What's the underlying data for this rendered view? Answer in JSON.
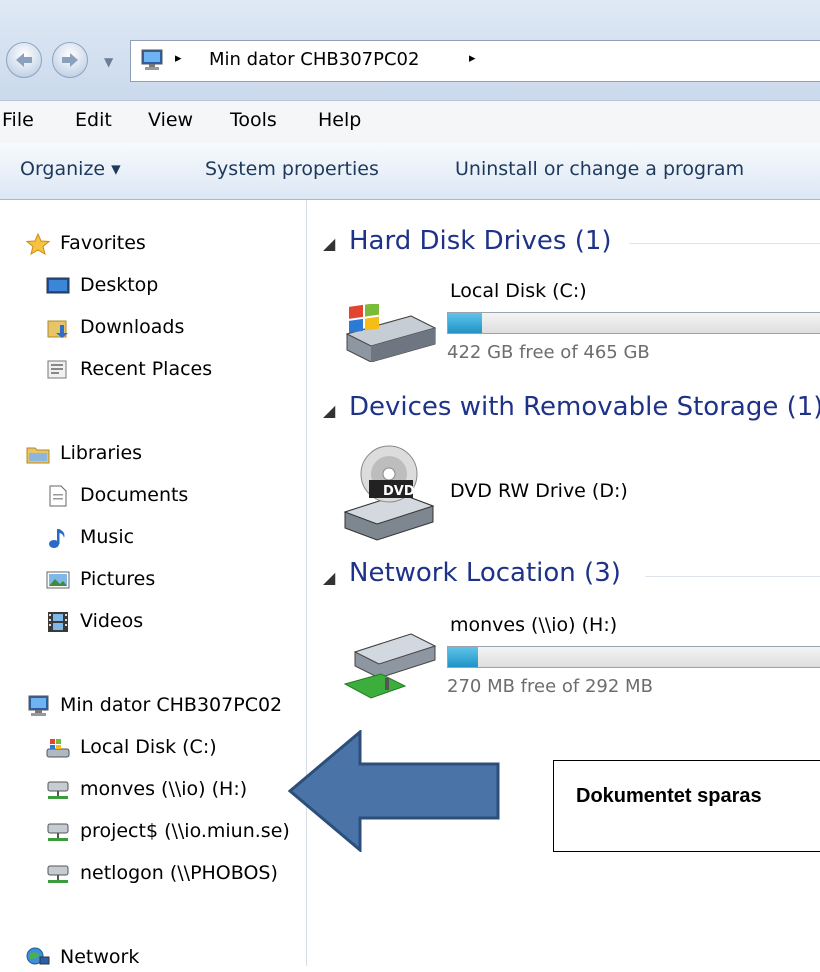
{
  "address": {
    "path": "Min dator CHB307PC02",
    "separator": "▸"
  },
  "menu": [
    "File",
    "Edit",
    "View",
    "Tools",
    "Help"
  ],
  "commands": {
    "organize": "Organize ▾",
    "system_properties": "System properties",
    "uninstall": "Uninstall or change a program"
  },
  "nav": {
    "favorites": "Favorites",
    "desktop": "Desktop",
    "downloads": "Downloads",
    "recent": "Recent Places",
    "libraries": "Libraries",
    "documents": "Documents",
    "music": "Music",
    "pictures": "Pictures",
    "videos": "Videos",
    "computer": "Min dator CHB307PC02",
    "local_disk": "Local Disk (C:)",
    "monves": "monves (\\\\io) (H:)",
    "project": "project$ (\\\\io.miun.se)",
    "netlogon": "netlogon (\\\\PHOBOS)",
    "network": "Network"
  },
  "groups": {
    "hdd": "Hard Disk Drives (1)",
    "removable": "Devices with Removable Storage (1)",
    "network": "Network Location (3)"
  },
  "drives": {
    "c_name": "Local Disk (C:)",
    "c_free": "422 GB free of 465 GB",
    "c_used_fraction": 0.09,
    "dvd_name": "DVD RW Drive (D:)",
    "dvd_label": "DVD",
    "h_name": "monves (\\\\io) (H:)",
    "h_free": "270 MB free of 292 MB",
    "h_used_fraction": 0.08
  },
  "callout": {
    "text": "Dokumentet sparas"
  },
  "colors": {
    "arrow": "#4a73a8",
    "group_heading": "#1e3287",
    "bar_fill": "#26a0da"
  }
}
